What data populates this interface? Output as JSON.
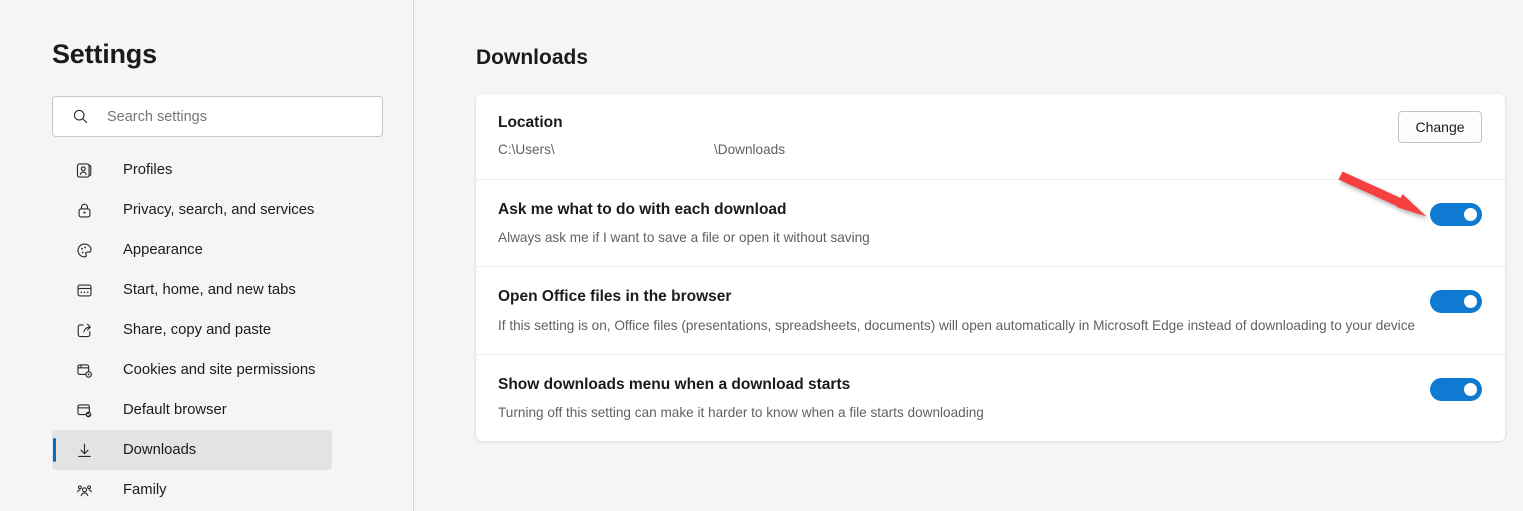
{
  "sidebar": {
    "title": "Settings",
    "search": {
      "placeholder": "Search settings",
      "value": "",
      "icon": "search-icon"
    },
    "items": [
      {
        "label": "Profiles",
        "icon": "profile-card-icon",
        "selected": false
      },
      {
        "label": "Privacy, search, and services",
        "icon": "lock-icon",
        "selected": false
      },
      {
        "label": "Appearance",
        "icon": "palette-icon",
        "selected": false
      },
      {
        "label": "Start, home, and new tabs",
        "icon": "window-icon",
        "selected": false
      },
      {
        "label": "Share, copy and paste",
        "icon": "share-icon",
        "selected": false
      },
      {
        "label": "Cookies and site permissions",
        "icon": "site-permissions-icon",
        "selected": false
      },
      {
        "label": "Default browser",
        "icon": "browser-check-icon",
        "selected": false
      },
      {
        "label": "Downloads",
        "icon": "download-arrow-icon",
        "selected": true
      },
      {
        "label": "Family",
        "icon": "people-icon",
        "selected": false
      }
    ]
  },
  "main": {
    "page_title": "Downloads",
    "location": {
      "title": "Location",
      "path_prefix": "C:\\Users\\",
      "path_suffix": "\\Downloads",
      "change_label": "Change"
    },
    "settings": [
      {
        "title": "Ask me what to do with each download",
        "description": "Always ask me if I want to save a file or open it without saving",
        "toggle_state": "on"
      },
      {
        "title": "Open Office files in the browser",
        "description": "If this setting is on, Office files (presentations, spreadsheets, documents) will open automatically in Microsoft Edge instead of downloading to your device",
        "toggle_state": "on"
      },
      {
        "title": "Show downloads menu when a download starts",
        "description": "Turning off this setting can make it harder to know when a file starts downloading",
        "toggle_state": "on"
      }
    ]
  },
  "annotation": {
    "type": "arrow",
    "color": "#f43f3f",
    "points_to": "ask-me-what-to-do-toggle"
  },
  "colors": {
    "accent": "#0f6cbd",
    "toggle_on": "#0f7ad1",
    "page_background": "#f5f5f5",
    "card_background": "#ffffff",
    "selected_nav_background": "#e3e3e3",
    "annotation_red": "#f43f3f"
  }
}
